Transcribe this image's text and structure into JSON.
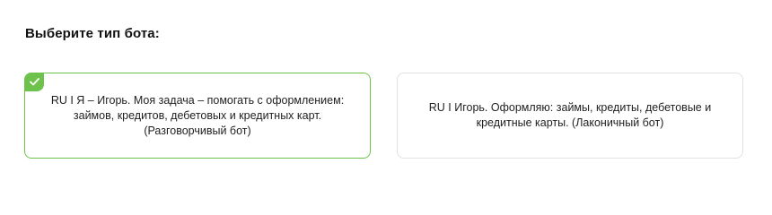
{
  "heading": "Выберите тип бота:",
  "options": [
    {
      "text": "RU I Я – Игорь. Моя задача – помогать с оформлением:\nзаймов, кредитов, дебетовых и кредитных карт.\n(Разговорчивый бот)",
      "selected": true
    },
    {
      "text": "RU I Игорь. Оформляю: займы, кредиты, дебетовые и\nкредитные карты. (Лаконичный бот)",
      "selected": false
    }
  ],
  "icons": {
    "check": "check-icon"
  },
  "colors": {
    "accent": "#6cc24a",
    "border": "#e2e2e2",
    "text": "#1f1f1f"
  }
}
